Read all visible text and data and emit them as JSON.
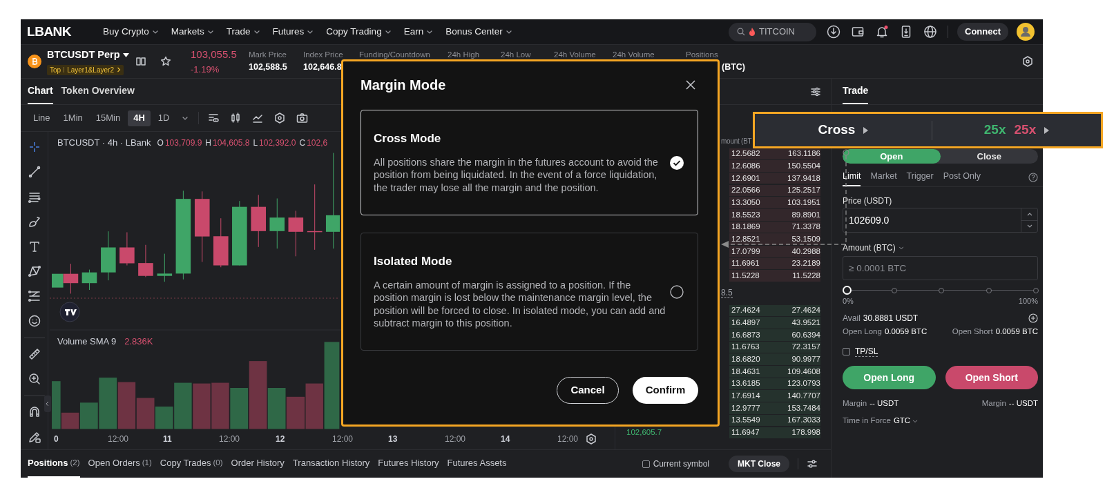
{
  "header": {
    "logo": "LBANK",
    "nav": [
      {
        "label": "Buy Crypto"
      },
      {
        "label": "Markets"
      },
      {
        "label": "Trade"
      },
      {
        "label": "Futures"
      },
      {
        "label": "Copy Trading"
      },
      {
        "label": "Earn"
      },
      {
        "label": "Bonus Center"
      }
    ],
    "search": {
      "placeholder": "TITCOIN"
    },
    "connect": "Connect"
  },
  "ticker": {
    "symbol": "BTCUSDT Perp",
    "tags": [
      "Top",
      "Layer1&Layer2"
    ],
    "price": "103,055.5",
    "change": "-1.19%",
    "stats": [
      {
        "label": "Mark Price",
        "value": "102,588.5"
      },
      {
        "label": "Index Price",
        "value": "102,646.8"
      },
      {
        "label": "Funding/Countdown"
      },
      {
        "label": "24h High"
      },
      {
        "label": "24h Low"
      },
      {
        "label": "24h Volume"
      },
      {
        "label": "24h Volume"
      },
      {
        "label": "Positions",
        "value_tail": "(BTC)"
      }
    ]
  },
  "chart_panel": {
    "tabs": [
      {
        "label": "Chart",
        "selected": true
      },
      {
        "label": "Token Overview",
        "selected": false
      }
    ],
    "intervals": [
      {
        "label": "Line",
        "selected": false
      },
      {
        "label": "1Min",
        "selected": false
      },
      {
        "label": "15Min",
        "selected": false
      },
      {
        "label": "4H",
        "selected": true
      },
      {
        "label": "1D",
        "selected": false
      }
    ],
    "legend": {
      "title": "BTCUSDT · 4h · LBank",
      "ohlc": [
        {
          "key": "O",
          "value": "103,709.9"
        },
        {
          "key": "H",
          "value": "104,605.8"
        },
        {
          "key": "L",
          "value": "102,392.0"
        },
        {
          "key": "C",
          "value": "102,6"
        }
      ]
    },
    "volume_legend": {
      "label": "Volume SMA 9",
      "value": "2.836K"
    },
    "time_axis": [
      "0",
      "12:00",
      "11",
      "12:00",
      "12",
      "12:00",
      "13",
      "12:00",
      "14",
      "12:00"
    ]
  },
  "order_book": {
    "column_partial": "mount (BT",
    "mid_partial": "8.5",
    "asks": [
      {
        "amount": "12.5682",
        "total": "163.1186"
      },
      {
        "amount": "12.6086",
        "total": "150.5504"
      },
      {
        "amount": "12.6901",
        "total": "137.9418"
      },
      {
        "amount": "22.0566",
        "total": "125.2517"
      },
      {
        "amount": "13.3050",
        "total": "103.1951"
      },
      {
        "amount": "18.5523",
        "total": "89.8901"
      },
      {
        "amount": "18.1869",
        "total": "71.3378"
      },
      {
        "amount": "12.8521",
        "total": "53.1509"
      },
      {
        "amount": "17.0799",
        "total": "40.2988"
      },
      {
        "amount": "11.6961",
        "total": "23.2189"
      },
      {
        "amount": "11.5228",
        "total": "11.5228"
      }
    ],
    "bids": [
      {
        "amount": "27.4624",
        "total": "27.4624"
      },
      {
        "amount": "16.4897",
        "total": "43.9521"
      },
      {
        "amount": "16.6873",
        "total": "60.6394"
      },
      {
        "amount": "11.6763",
        "total": "72.3157"
      },
      {
        "amount": "18.6820",
        "total": "90.9977"
      },
      {
        "amount": "18.4631",
        "total": "109.4608"
      },
      {
        "amount": "13.6185",
        "total": "123.0793"
      },
      {
        "amount": "17.6914",
        "total": "140.7707"
      },
      {
        "amount": "12.9777",
        "total": "153.7484"
      },
      {
        "amount": "13.5549",
        "total": "167.3033"
      },
      {
        "price": "102,605.7",
        "amount": "11.6947",
        "total": "178.998"
      }
    ]
  },
  "trade_panel": {
    "tabs": [
      {
        "label": "Trade",
        "selected": true
      }
    ],
    "sides": [
      {
        "label": "Open",
        "selected": true
      },
      {
        "label": "Close",
        "selected": false
      }
    ],
    "order_types": [
      {
        "label": "Limit",
        "selected": true
      },
      {
        "label": "Market",
        "selected": false
      },
      {
        "label": "Trigger",
        "selected": false
      },
      {
        "label": "Post Only",
        "selected": false
      }
    ],
    "price": {
      "label": "Price (USDT)",
      "value": "102609.0"
    },
    "amount": {
      "label": "Amount (BTC)",
      "placeholder": "≥ 0.0001 BTC"
    },
    "slider": {
      "level": 0,
      "min_label": "0%",
      "max_label": "100%"
    },
    "avail": {
      "label": "Avail",
      "value": "30.8881 USDT"
    },
    "open_long": {
      "label": "Open Long",
      "value": "0.0059 BTC"
    },
    "open_short": {
      "label": "Open Short",
      "value": "0.0059 BTC"
    },
    "tpsl": {
      "label": "TP/SL",
      "checked": false
    },
    "buttons": [
      {
        "label": "Open Long",
        "kind": "long"
      },
      {
        "label": "Open Short",
        "kind": "short"
      }
    ],
    "margins": [
      {
        "label": "Margin",
        "value": "-- USDT"
      },
      {
        "label": "Margin",
        "value": "-- USDT"
      }
    ],
    "time_in_force": {
      "label": "Time in Force",
      "value": "GTC"
    }
  },
  "bottom_tabs": [
    {
      "label": "Positions",
      "count": "(2)",
      "selected": true
    },
    {
      "label": "Open Orders",
      "count": "(1)",
      "selected": false
    },
    {
      "label": "Copy Trades",
      "count": "(0)",
      "selected": false
    },
    {
      "label": "Order History",
      "selected": false
    },
    {
      "label": "Transaction History",
      "selected": false
    },
    {
      "label": "Futures History",
      "selected": false
    },
    {
      "label": "Futures Assets",
      "selected": false
    }
  ],
  "current_symbol": {
    "label": "Current symbol",
    "checked": false
  },
  "mkt_close": "MKT Close",
  "margin_mode_dialog": {
    "title": "Margin Mode",
    "options": [
      {
        "title": "Cross Mode",
        "description": "All positions share the margin in the futures account to avoid the position from being liquidated. In the event of a force liquidation, the trader may lose all the margin and the position.",
        "selected": true
      },
      {
        "title": "Isolated Mode",
        "description": "A certain amount of margin is assigned to a position. If the position margin is lost below the maintenance margin level, the position will be forced to close. In isolated mode, you can add and subtract margin to this position.",
        "selected": false
      }
    ],
    "buttons": [
      {
        "label": "Cancel",
        "kind": "secondary"
      },
      {
        "label": "Confirm",
        "kind": "primary"
      }
    ]
  },
  "leverage_callout": {
    "mode": "Cross",
    "long_leverage": "25x",
    "short_leverage": "25x"
  }
}
